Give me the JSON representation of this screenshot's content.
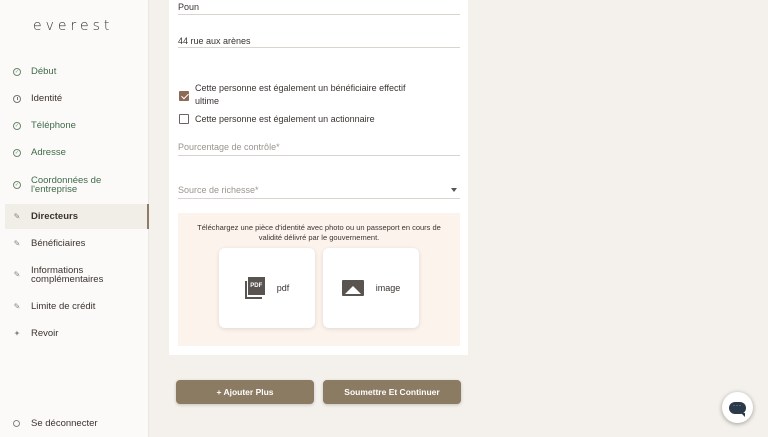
{
  "app": {
    "logo": "everest"
  },
  "sidebar": {
    "items": [
      {
        "label": "Début",
        "state": "done",
        "icon": "check-circle-icon"
      },
      {
        "label": "Identité",
        "state": "todo",
        "icon": "clock-icon"
      },
      {
        "label": "Téléphone",
        "state": "done",
        "icon": "check-circle-icon"
      },
      {
        "label": "Adresse",
        "state": "done",
        "icon": "check-circle-icon"
      },
      {
        "label": "Coordonnées de l'entreprise",
        "label_line1": "Coordonnées de",
        "label_line2": "l'entreprise",
        "state": "done",
        "icon": "check-circle-icon"
      },
      {
        "label": "Directeurs",
        "state": "active",
        "icon": "pencil-icon"
      },
      {
        "label": "Bénéficiaires",
        "state": "todo",
        "icon": "pencil-icon"
      },
      {
        "label": "Informations complémentaires",
        "label_line1": "Informations",
        "label_line2": "complémentaires",
        "state": "todo",
        "icon": "pencil-icon"
      },
      {
        "label": "Limite de crédit",
        "state": "todo",
        "icon": "pencil-icon"
      },
      {
        "label": "Revoir",
        "state": "todo",
        "icon": "review-icon"
      }
    ],
    "logout": "Se déconnecter"
  },
  "form": {
    "last_name_value": "Poun",
    "address_value": "44 rue aux arènes",
    "checkbox_beneficiary": {
      "line1": "Cette personne est également un bénéficiaire effectif",
      "line2": "ultime",
      "checked": true
    },
    "checkbox_shareholder": {
      "label": "Cette personne est également un actionnaire",
      "checked": false
    },
    "control_percentage_placeholder": "Pourcentage de contrôle*",
    "wealth_source_placeholder": "Source de richesse*",
    "upload": {
      "instructions_line1": "Téléchargez une pièce d'identité avec photo ou un passeport en cours de",
      "instructions_line2": "validité délivré par le gouvernement.",
      "pdf_label": "pdf",
      "pdf_icon_text": "PDF",
      "image_label": "image"
    }
  },
  "actions": {
    "add_more": "+ Ajouter Plus",
    "submit": "Soumettre Et Continuer"
  },
  "colors": {
    "accent": "#8b7b63",
    "done_text": "#3e6a4a",
    "background": "#f4f1ec"
  }
}
